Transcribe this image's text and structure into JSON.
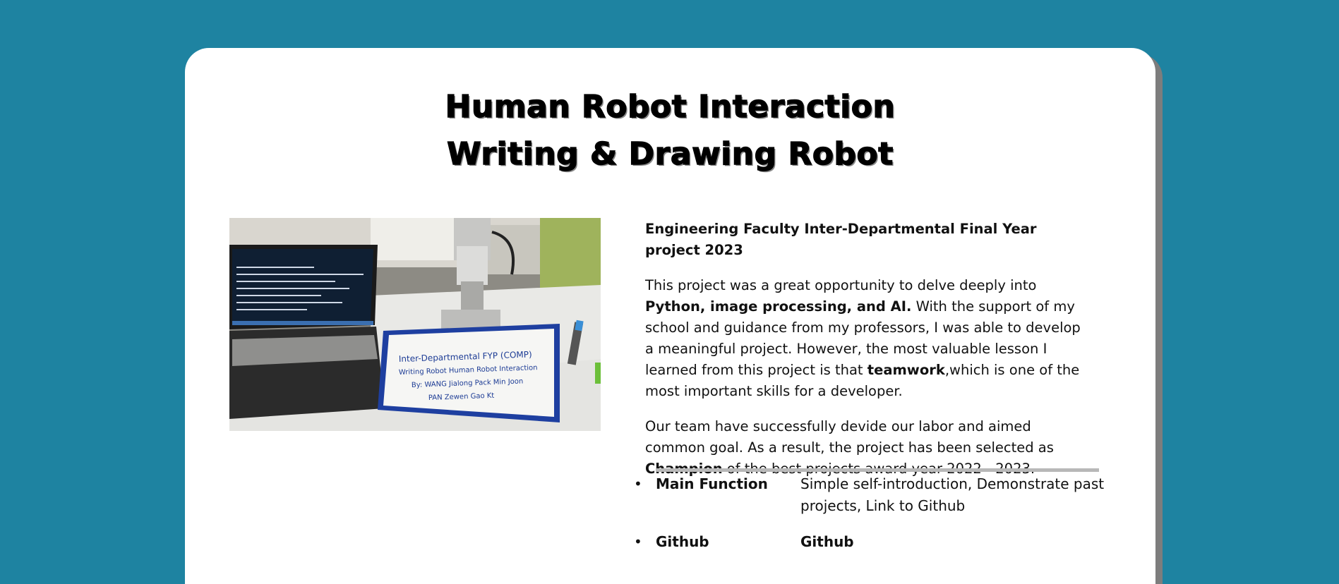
{
  "header": {
    "title_line1": "Human Robot Interaction",
    "title_line2": "Writing & Drawing Robot"
  },
  "photo": {
    "whiteboard_line1": "Inter-Departmental FYP (COMP)",
    "whiteboard_line2": "Writing Robot Human Robot Interaction",
    "whiteboard_line3": "By: WANG Jialong  Pack Min Joon",
    "whiteboard_line4": "PAN Zewen   Gao Kt"
  },
  "info": {
    "subheading": "Engineering Faculty Inter-Departmental Final Year project 2023",
    "p1_a": "This project was a great opportunity to delve deeply into ",
    "p1_b": "Python, image processing, and AI.",
    "p1_c": " With the support of my school and guidance from my professors, I was able to develop a meaningful project. However, the most valuable lesson I learned from this project is that ",
    "p1_d": "teamwork",
    "p1_e": ",which is one of the most important skills for a developer.",
    "p2_a": "Our team have successfully devide our labor and aimed common goal. As a result, the project has been selected as ",
    "p2_b": "Champion",
    "p2_c": " of the best projects award year 2022 - 2023."
  },
  "features": [
    {
      "key": "Main Function",
      "value": "Simple self-introduction, Demonstrate past projects, Link to Github"
    },
    {
      "key": "Github",
      "value": "Github"
    }
  ],
  "colors": {
    "background": "#1e83a1",
    "card": "#ffffff",
    "shadow": "#7d7d7d"
  }
}
